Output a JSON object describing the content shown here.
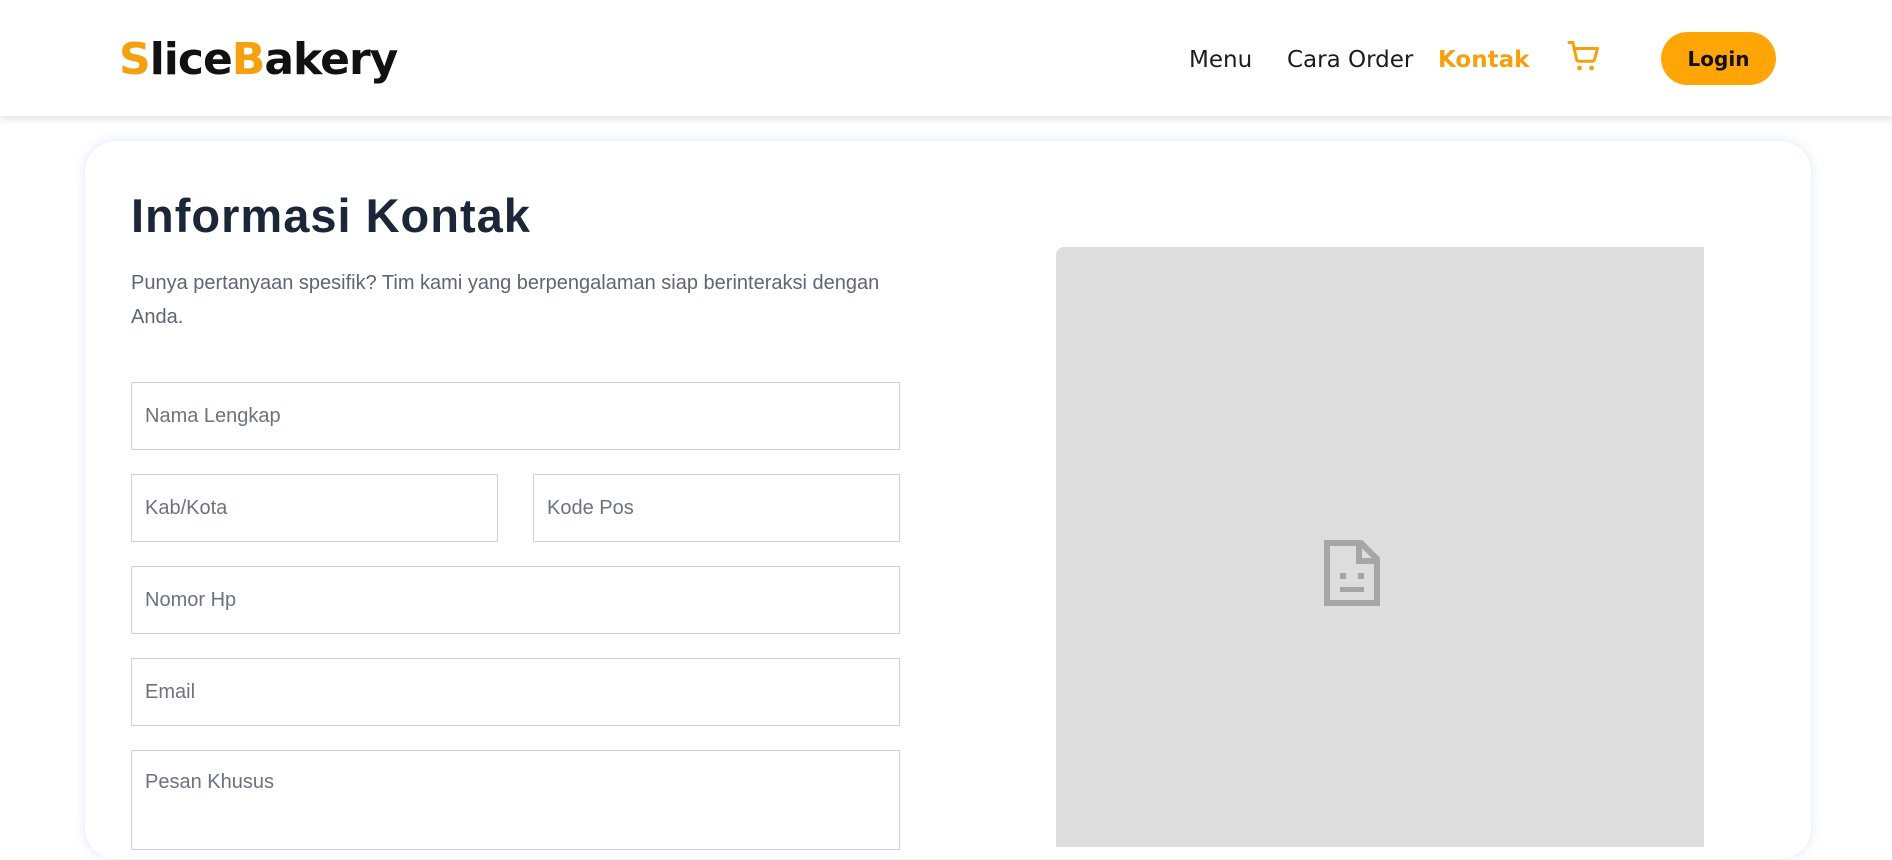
{
  "header": {
    "logo": {
      "s": "S",
      "lice": "lice",
      "b": "B",
      "akery": "akery"
    },
    "nav": {
      "menu": "Menu",
      "cara_order": "Cara Order",
      "kontak": "Kontak"
    },
    "cart_icon": "cart-icon",
    "login_label": "Login"
  },
  "main": {
    "title": "Informasi Kontak",
    "description": "Punya pertanyaan spesifik? Tim kami yang berpengalaman siap berinteraksi dengan Anda.",
    "form": {
      "nama_placeholder": "Nama Lengkap",
      "kota_placeholder": "Kab/Kota",
      "kode_pos_placeholder": "Kode Pos",
      "nomor_hp_placeholder": "Nomor Hp",
      "email_placeholder": "Email",
      "pesan_placeholder": "Pesan Khusus"
    },
    "map_icon": "broken-document-icon"
  },
  "colors": {
    "accent": "#FFA606",
    "brand_orange": "#F5A00E",
    "title": "#1b2738",
    "text_muted": "#5d6674",
    "map_placeholder": "#dddddd"
  }
}
